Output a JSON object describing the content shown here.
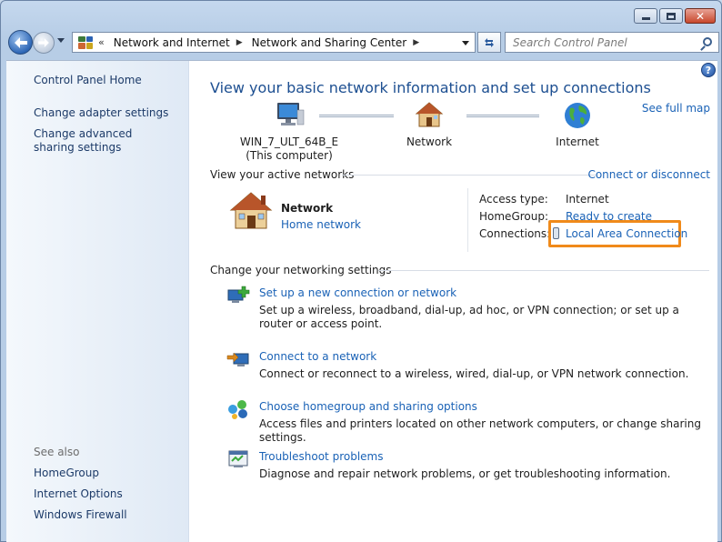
{
  "address": {
    "overflow": "«",
    "crumbs": [
      "Network and Internet",
      "Network and Sharing Center"
    ],
    "search_placeholder": "Search Control Panel"
  },
  "sidebar": {
    "home": "Control Panel Home",
    "links": [
      "Change adapter settings",
      "Change advanced sharing settings"
    ],
    "see_also_label": "See also",
    "see_also": [
      "HomeGroup",
      "Internet Options",
      "Windows Firewall"
    ]
  },
  "main": {
    "title": "View your basic network information and set up connections",
    "see_full_map": "See full map",
    "map": {
      "computer_name": "WIN_7_ULT_64B_E",
      "computer_sub": "(This computer)",
      "network": "Network",
      "internet": "Internet"
    },
    "active": {
      "heading": "View your active networks",
      "connect_link": "Connect or disconnect",
      "network_name": "Network",
      "network_type": "Home network",
      "access_type_label": "Access type:",
      "access_type_value": "Internet",
      "homegroup_label": "HomeGroup:",
      "homegroup_value": "Ready to create",
      "connections_label": "Connections:",
      "connections_value": "Local Area Connection"
    },
    "settings": {
      "heading": "Change your networking settings",
      "tasks": [
        {
          "link": "Set up a new connection or network",
          "desc": "Set up a wireless, broadband, dial-up, ad hoc, or VPN connection; or set up a router or access point."
        },
        {
          "link": "Connect to a network",
          "desc": "Connect or reconnect to a wireless, wired, dial-up, or VPN network connection."
        },
        {
          "link": "Choose homegroup and sharing options",
          "desc": "Access files and printers located on other network computers, or change sharing settings."
        },
        {
          "link": "Troubleshoot problems",
          "desc": "Diagnose and repair network problems, or get troubleshooting information."
        }
      ]
    }
  },
  "colors": {
    "link": "#1a62b6",
    "title": "#1d4f91",
    "highlight": "#f08a1a"
  }
}
